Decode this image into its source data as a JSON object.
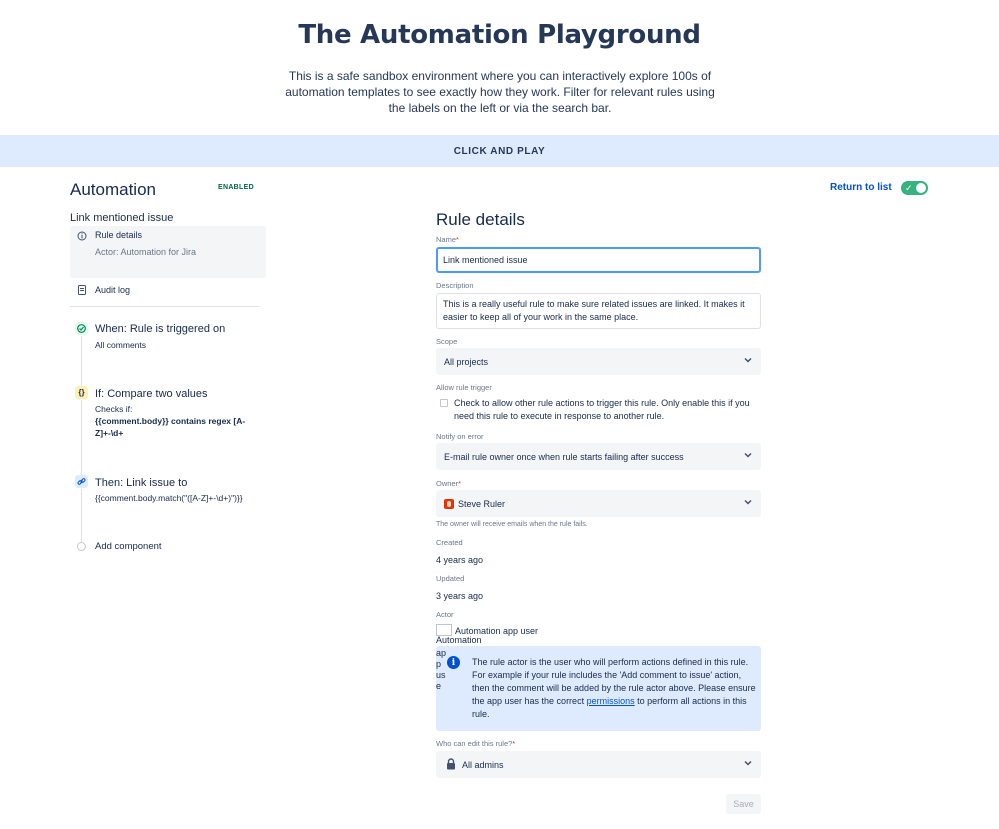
{
  "hero": {
    "title": "The Automation Playground",
    "description": "This is a safe sandbox environment where you can interactively explore 100s of automation templates to see exactly how they work. Filter for relevant rules using the labels on the left or via the search bar."
  },
  "band": {
    "label": "CLICK AND PLAY"
  },
  "header": {
    "title": "Automation",
    "status": "ENABLED",
    "return_link": "Return to list",
    "toggle_on": true
  },
  "sidebar": {
    "rule_name": "Link mentioned issue",
    "rule_details_label": "Rule details",
    "actor_line": "Actor: Automation for Jira",
    "audit_log_label": "Audit log"
  },
  "flow": {
    "trigger": {
      "title": "When: Rule is triggered on",
      "subtitle": "All comments"
    },
    "condition": {
      "title": "If: Compare two values",
      "checks_label": "Checks if:",
      "expression": "{{comment.body}} contains regex [A-Z]+-\\d+"
    },
    "action": {
      "title": "Then: Link issue to",
      "expression": "{{comment.body.match(\"([A-Z]+-\\d+)\")}}"
    },
    "add_component": "Add component"
  },
  "form": {
    "title": "Rule details",
    "name_label": "Name",
    "name_value": "Link mentioned issue",
    "description_label": "Description",
    "description_value": "This is a really useful rule to make sure related issues are linked. It makes it easier to keep all of your work in the same place.",
    "scope_label": "Scope",
    "scope_value": "All projects",
    "allow_trigger_label": "Allow rule trigger",
    "allow_trigger_text": "Check to allow other rule actions to trigger this rule. Only enable this if you need this rule to execute in response to another rule.",
    "notify_label": "Notify on error",
    "notify_value": "E-mail rule owner once when rule starts failing after success",
    "owner_label": "Owner",
    "owner_value": "Steve Ruler",
    "owner_helper": "The owner will receive emails when the rule fails.",
    "created_label": "Created",
    "created_value": "4 years ago",
    "updated_label": "Updated",
    "updated_value": "3 years ago",
    "actor_label": "Actor",
    "actor_name": "Automation app user",
    "actor_alt": "Automation",
    "actor_alt_overlap": "app use",
    "info_before_link": "The rule actor is the user who will perform actions defined in this rule. For example if your rule includes the 'Add comment to issue' action, then the comment will be added by the rule actor above. Please ensure the app user has the correct ",
    "info_link": "permissions",
    "info_after_link": " to perform all actions in this rule.",
    "editors_label": "Who can edit this rule?",
    "editors_value": "All admins",
    "save_label": "Save",
    "required_mark": "*",
    "checks_prefix": "Checks if:"
  }
}
